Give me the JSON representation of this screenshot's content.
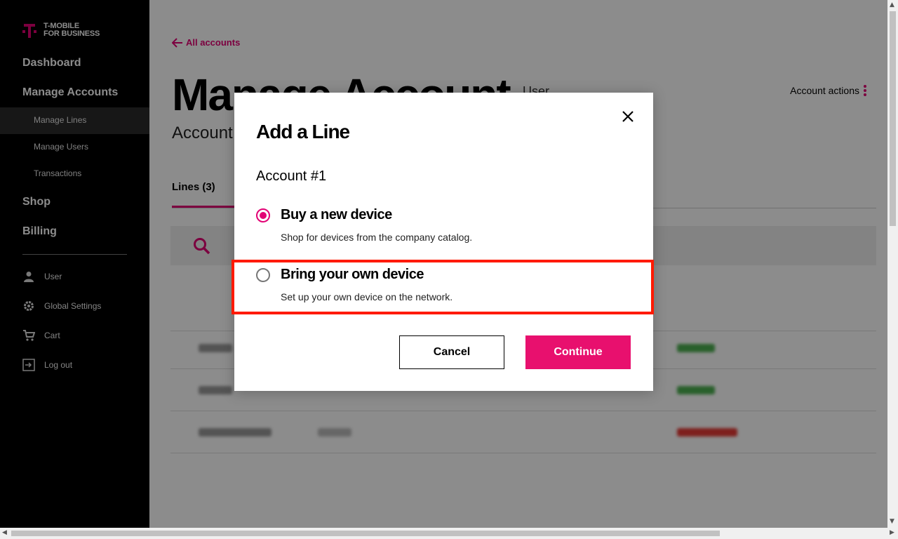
{
  "brand": {
    "line1": "T-MOBILE",
    "line2": "FOR BUSINESS",
    "accent": "#e20074"
  },
  "sidebar": {
    "dashboard": "Dashboard",
    "manage_accounts": "Manage Accounts",
    "manage_lines": "Manage Lines",
    "manage_users": "Manage Users",
    "transactions": "Transactions",
    "shop": "Shop",
    "billing": "Billing",
    "user": "User",
    "global_settings": "Global Settings",
    "cart": "Cart",
    "logout": "Log out"
  },
  "main": {
    "back_link": "All accounts",
    "title": "Manage Account",
    "user_label": "User",
    "account_label": "Account",
    "account_actions": "Account actions",
    "tab_lines": "Lines (3)"
  },
  "modal": {
    "title": "Add a Line",
    "account": "Account #1",
    "options": [
      {
        "title": "Buy a new device",
        "description": "Shop for devices from the company catalog.",
        "selected": true
      },
      {
        "title": "Bring your own device",
        "description": "Set up your own device on the network.",
        "selected": false
      }
    ],
    "cancel": "Cancel",
    "continue": "Continue"
  },
  "colors": {
    "highlight": "#ff1a00",
    "continue_bg": "#e8106e"
  }
}
